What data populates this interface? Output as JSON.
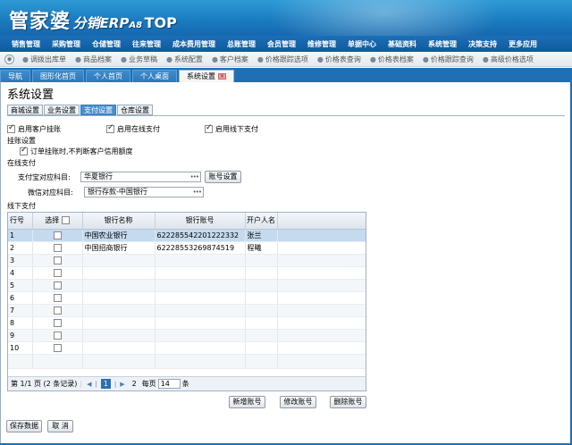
{
  "app": {
    "logo_main": "管家婆",
    "logo_sub": "分销ERP",
    "logo_version": "A8",
    "logo_suffix": "TOP"
  },
  "main_menu": [
    "销售管理",
    "采购管理",
    "仓储管理",
    "往来管理",
    "成本费用管理",
    "总账管理",
    "会员管理",
    "维修管理",
    "单据中心",
    "基础资料",
    "系统管理",
    "决策支持",
    "更多应用"
  ],
  "sub_menu": [
    "调拨出库单",
    "商品档案",
    "业务草稿",
    "系统配置",
    "客户档案",
    "价格跟踪选项",
    "价格表查询",
    "价格表档案",
    "价格跟踪查询",
    "高级价格选项"
  ],
  "page_tabs": [
    "导航",
    "图形化首页",
    "个人首页",
    "个人桌面",
    "系统设置"
  ],
  "page": {
    "title": "系统设置",
    "subtabs": [
      "商城设置",
      "业务设置",
      "支付设置",
      "仓库设置"
    ],
    "active_subtab": 2
  },
  "settings": {
    "enable_credit": "启用客户挂账",
    "enable_online": "启用在线支付",
    "enable_offline": "启用线下支付",
    "credit_section": "挂账设置",
    "credit_option": "订单挂账时,不判断客户信用额度",
    "online_section": "在线支付",
    "alipay_label": "支付宝对应科目:",
    "alipay_value": "华夏银行",
    "account_setting_btn": "账号设置",
    "wechat_label": "微信对应科目:",
    "wechat_value": "银行存款-中国银行",
    "offline_section": "线下支付"
  },
  "grid": {
    "headers": [
      "行号",
      "选择",
      "银行名称",
      "银行账号",
      "开户人名"
    ],
    "rows": [
      {
        "no": "1",
        "bank": "中国农业银行",
        "account": "6222855422012223​32",
        "holder": "张兰"
      },
      {
        "no": "2",
        "bank": "中国招商银行",
        "account": "622285532698745​19",
        "holder": "程曦"
      },
      {
        "no": "3",
        "bank": "",
        "account": "",
        "holder": ""
      },
      {
        "no": "4",
        "bank": "",
        "account": "",
        "holder": ""
      },
      {
        "no": "5",
        "bank": "",
        "account": "",
        "holder": ""
      },
      {
        "no": "6",
        "bank": "",
        "account": "",
        "holder": ""
      },
      {
        "no": "7",
        "bank": "",
        "account": "",
        "holder": ""
      },
      {
        "no": "8",
        "bank": "",
        "account": "",
        "holder": ""
      },
      {
        "no": "9",
        "bank": "",
        "account": "",
        "holder": ""
      },
      {
        "no": "10",
        "bank": "",
        "account": "",
        "holder": ""
      }
    ]
  },
  "pager": {
    "summary": "第 1/1 页 (2 条记录)",
    "current": "1",
    "next_page": "2",
    "per_page_label": "每页",
    "per_page_value": "14",
    "unit": "条"
  },
  "actions": {
    "add": "新增账号",
    "edit": "修改账号",
    "delete": "删除账号",
    "save": "保存数据",
    "cancel": "取 消"
  },
  "colors": {
    "banner": "#1b7cc0",
    "menu": "#105a9e",
    "selected_row": "#c5daee",
    "active_subtab": "#4a8fd0"
  }
}
